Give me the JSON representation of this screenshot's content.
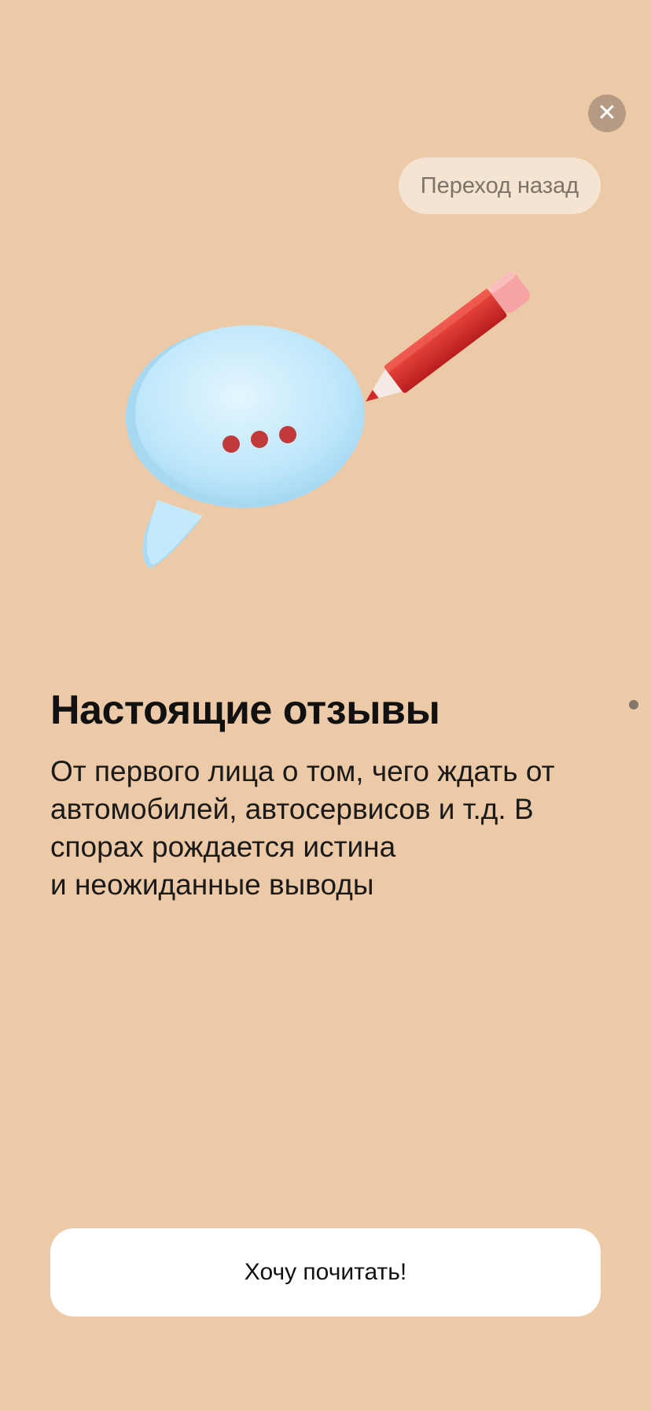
{
  "header": {
    "close_icon": "close-icon",
    "back_label": "Переход назад"
  },
  "illustration": {
    "icons": [
      "speech-bubble-icon",
      "pencil-icon"
    ]
  },
  "content": {
    "title": "Настоящие отзывы",
    "description": "От первого лица о том, чего ждать от\nавтомобилей, автосервисов и т.д. В\nспорах рождается истина\nи неожиданные выводы"
  },
  "pagination": {
    "dots": 1
  },
  "footer": {
    "cta_label": "Хочу почитать!"
  },
  "colors": {
    "background": "#EDCAA7",
    "close_button": "#B69B84",
    "back_pill": "#F5E4D2",
    "button": "#FFFFFF",
    "pencil": "#D62A2A",
    "bubble": "#BDE6FA"
  }
}
